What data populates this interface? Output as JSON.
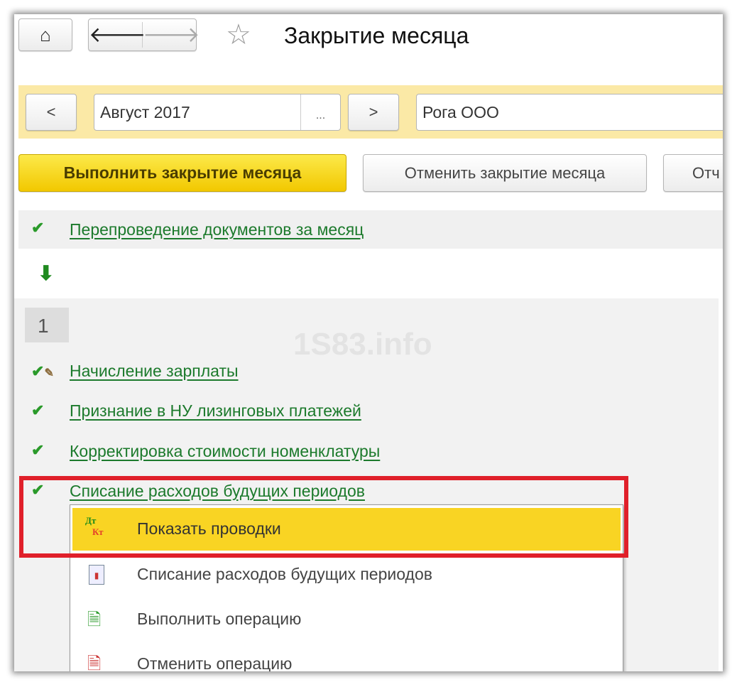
{
  "header": {
    "title": "Закрытие месяца"
  },
  "filters": {
    "period": "Август 2017",
    "prev": "<",
    "next": ">",
    "ellipsis": "...",
    "organization": "Рога ООО"
  },
  "actions": {
    "run": "Выполнить закрытие месяца",
    "cancel": "Отменить закрытие месяца",
    "report": "Отч"
  },
  "steps": {
    "reposting": "Перепроведение документов за месяц",
    "stage_number": "1",
    "items": [
      "Начисление зарплаты",
      "Признание в НУ лизинговых платежей",
      "Корректировка стоимости номенклатуры",
      "Списание расходов будущих периодов"
    ]
  },
  "watermark": "1S83.info",
  "context_menu": {
    "items": [
      "Показать проводки",
      "Списание расходов будущих периодов",
      "Выполнить операцию",
      "Отменить операцию"
    ],
    "dt": "Дт",
    "kt": "Кт"
  },
  "colors": {
    "accent_yellow": "#f9d423",
    "link_green": "#1c7a2c",
    "highlight_red": "#e0202a",
    "filter_band": "#fbe9a6"
  }
}
